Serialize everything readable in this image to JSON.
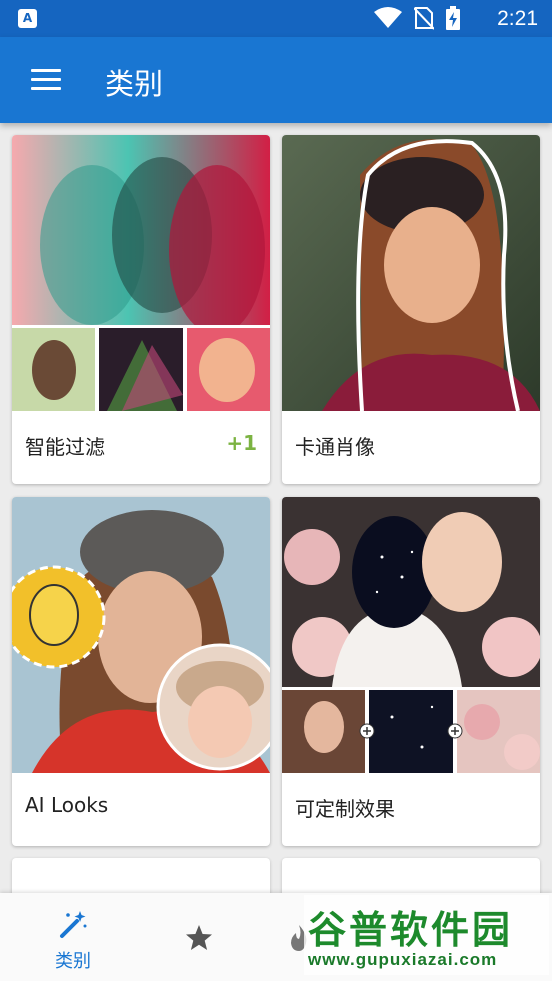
{
  "status_bar": {
    "time": "2:21",
    "icons": [
      "notification-app-icon",
      "wifi-icon",
      "no-sim-icon",
      "battery-charging-icon"
    ]
  },
  "app_bar": {
    "title": "类别",
    "menu_icon": "hamburger-menu-icon"
  },
  "categories": [
    {
      "label": "智能过滤",
      "badge": "+1"
    },
    {
      "label": "卡通肖像"
    },
    {
      "label": "AI Looks"
    },
    {
      "label": "可定制效果"
    }
  ],
  "bottom_nav": {
    "items": [
      {
        "label": "类别",
        "icon": "magic-wand-icon",
        "active": true
      },
      {
        "label": "",
        "icon": "star-icon"
      },
      {
        "label": "",
        "icon": "flame-icon"
      }
    ],
    "active_color": "#1976d2"
  },
  "watermark": {
    "title": "谷普软件园",
    "url": "www.gupuxiazai.com"
  },
  "colors": {
    "status_bar": "#1565c0",
    "app_bar": "#1976d2",
    "badge": "#7cb342"
  }
}
